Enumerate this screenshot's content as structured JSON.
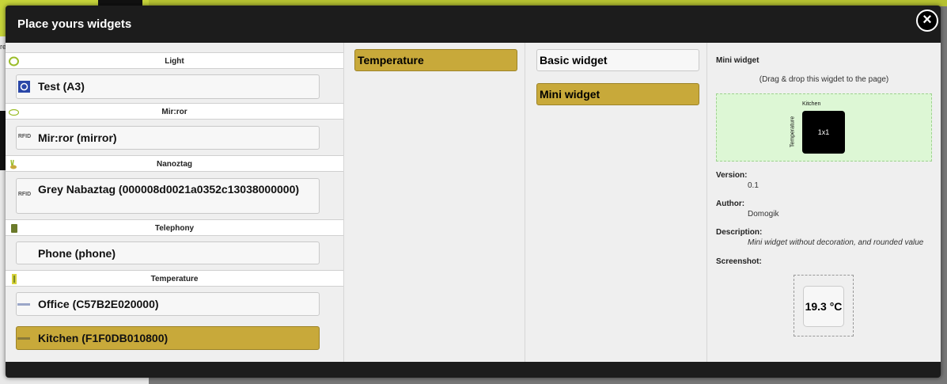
{
  "dialog": {
    "title": "Place yours widgets",
    "close_icon": "×"
  },
  "background": {
    "partial_text": "re"
  },
  "features": {
    "categories": [
      {
        "name": "Light",
        "icon": "bulb-icon",
        "items": [
          {
            "label": "Test (A3)",
            "icon": "device-icon",
            "selected": false
          }
        ]
      },
      {
        "name": "Mir:ror",
        "icon": "mirror-icon",
        "items": [
          {
            "label": "Mir:ror (mirror)",
            "icon": "rfid-icon",
            "icon_text": "RFID",
            "selected": false
          }
        ]
      },
      {
        "name": "Nanoztag",
        "icon": "rabbit-icon",
        "items": [
          {
            "label": "Grey Nabaztag (000008d0021a0352c13038000000)",
            "icon": "rfid-icon",
            "icon_text": "RFID",
            "selected": false
          }
        ]
      },
      {
        "name": "Telephony",
        "icon": "phone-icon",
        "items": [
          {
            "label": "Phone (phone)",
            "icon": "",
            "selected": false
          }
        ]
      },
      {
        "name": "Temperature",
        "icon": "thermometer-icon",
        "items": [
          {
            "label": "Office (C57B2E020000)",
            "icon": "onewire-icon",
            "selected": false
          },
          {
            "label": "Kitchen (F1F0DB010800)",
            "icon": "onewire-icon",
            "selected": true
          }
        ]
      }
    ]
  },
  "types": [
    {
      "label": "Temperature",
      "selected": true
    }
  ],
  "widgets": [
    {
      "label": "Basic widget",
      "selected": false
    },
    {
      "label": "Mini widget",
      "selected": true
    }
  ],
  "detail": {
    "title": "Mini widget",
    "drag_hint": "(Drag & drop this wigdet to the page)",
    "preview": {
      "device": "Kitchen",
      "type": "Temperature",
      "size": "1x1"
    },
    "version_label": "Version:",
    "version": "0.1",
    "author_label": "Author:",
    "author": "Domogik",
    "description_label": "Description:",
    "description": "Mini widget without decoration, and rounded value",
    "screenshot_label": "Screenshot:",
    "screenshot_value": "19.3 °C"
  },
  "colors": {
    "selected": "#c8a93a",
    "dialog_bg": "#1c1c1c",
    "preview_bg": "#ddf7d5"
  }
}
